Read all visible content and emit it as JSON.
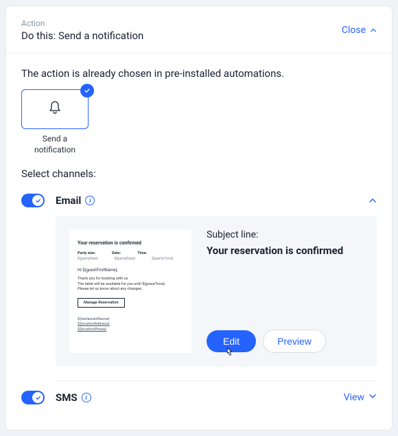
{
  "header": {
    "eyebrow": "Action",
    "title": "Do this: Send a notification",
    "close_label": "Close"
  },
  "intro": "The action is already chosen in pre-installed automations.",
  "tile": {
    "caption": "Send a notification"
  },
  "select_channels_label": "Select channels:",
  "channels": {
    "email": {
      "name": "Email",
      "subject_label": "Subject line:",
      "subject": "Your reservation is confirmed",
      "edit_label": "Edit",
      "preview_label": "Preview",
      "preview": {
        "title": "Your reservation is confirmed",
        "labels": {
          "party": "Party size:",
          "date": "Date:",
          "time": "Time:"
        },
        "values": {
          "party": "${partySize}",
          "date": "${partyDate}",
          "time": "${partyTime}"
        },
        "greeting": "Hi ${guestFirstName},",
        "body_l1": "Thank you for booking with us.",
        "body_l2": "The table will be available for you until ${graceTime}.",
        "body_l3": "Please let us know about any changes.",
        "manage_btn": "Manage Reservation",
        "footer_l1": "${restaurantName}",
        "footer_l2": "${locationAddress}",
        "footer_l3": "${locationPhone}"
      }
    },
    "sms": {
      "name": "SMS",
      "view_label": "View"
    }
  }
}
